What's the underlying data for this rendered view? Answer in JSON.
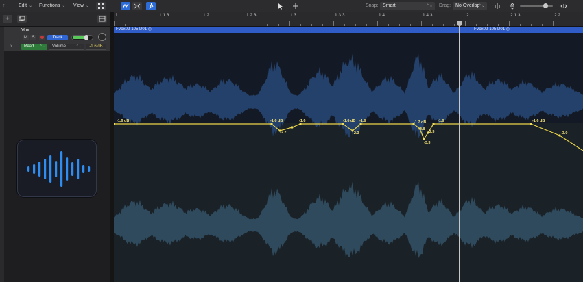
{
  "toolbar": {
    "edit_label": "Edit",
    "functions_label": "Functions",
    "view_label": "View",
    "snap_label": "Snap:",
    "snap_value": "Smart",
    "drag_label": "Drag:",
    "drag_value": "No Overlap"
  },
  "tracklist": {
    "add_label": "+"
  },
  "track": {
    "name": "Vox",
    "mute_label": "M",
    "solo_label": "S",
    "track_button_label": "Track",
    "automation_mode": "Read",
    "automation_param": "Volume",
    "automation_value": "-1.6 dB",
    "volume_level_fraction": 0.72
  },
  "ruler": {
    "labels": [
      {
        "text": "1",
        "pos": 0
      },
      {
        "text": "1 1 3",
        "pos": 0
      },
      {
        "text": "1 2",
        "pos": 0
      },
      {
        "text": "1 2 3",
        "pos": 0
      },
      {
        "text": "1 3",
        "pos": 0
      },
      {
        "text": "1 3 3",
        "pos": 0
      },
      {
        "text": "1 4",
        "pos": 0
      },
      {
        "text": "1 4 3",
        "pos": 0
      },
      {
        "text": "2",
        "pos": 0
      },
      {
        "text": "2 1 3",
        "pos": 0
      },
      {
        "text": "2 2",
        "pos": 0
      }
    ]
  },
  "regions": [
    {
      "name": "FVox02-105 D01"
    },
    {
      "name": "FVox02-105 D01"
    }
  ],
  "automation_labels": [
    "-1.6 dB",
    "-1.6 dB",
    "-2.2",
    "-1.6",
    "-1.6 dB",
    "-2.3",
    "-1.6",
    "-1.7 dB",
    "-2.8",
    "-2.3",
    "-3.3",
    "-1.6",
    "-1.6 dB",
    "-3.0"
  ],
  "colors": {
    "waveform_top": "#24416b",
    "waveform_bottom": "#2f4a5c",
    "automation_line": "#e9d34a",
    "region_bar": "#2f5cc7",
    "track_button": "#2f66d3",
    "read_button": "#2e7a3a"
  }
}
